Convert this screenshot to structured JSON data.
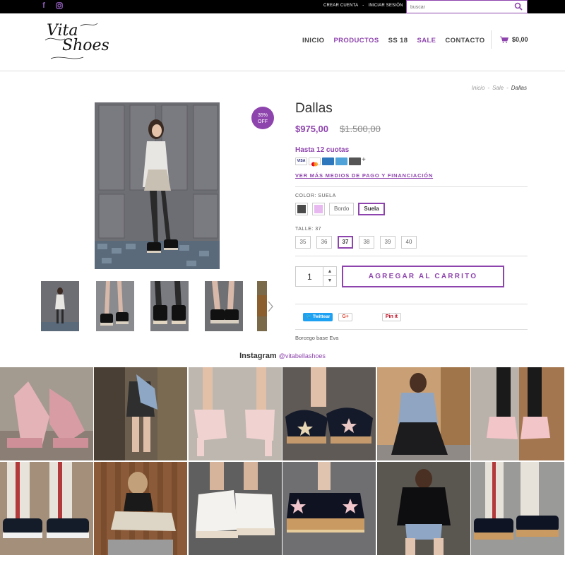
{
  "topbar": {
    "social_icons": [
      "facebook-icon",
      "instagram-icon"
    ],
    "create_account": "CREAR CUENTA",
    "separator": "-",
    "login": "INICIAR SESIÓN",
    "search_placeholder": "buscar"
  },
  "header": {
    "logo_line1": "Vita",
    "logo_line2": "Shoes",
    "nav": [
      {
        "label": "INICIO",
        "accent": false
      },
      {
        "label": "PRODUCTOS",
        "accent": true
      },
      {
        "label": "SS 18",
        "accent": false
      },
      {
        "label": "SALE",
        "accent": true
      },
      {
        "label": "CONTACTO",
        "accent": false
      }
    ],
    "cart_total": "$0,00"
  },
  "breadcrumb": {
    "items": [
      "Inicio",
      "Sale"
    ],
    "current": "Dallas"
  },
  "product": {
    "discount_pct": "35%",
    "discount_word": "OFF",
    "name": "Dallas",
    "price": "$975,00",
    "old_price": "$1.500,00",
    "installments": "Hasta 12 cuotas",
    "payment_link": "VER MÁS MEDIOS DE PAGO Y FINANCIACIÓN",
    "color_label": "COLOR: SUELA",
    "colors": [
      {
        "type": "swatch",
        "hex": "#4a4a4a",
        "selected": false
      },
      {
        "type": "swatch",
        "hex": "#e8b8f0",
        "selected": false
      },
      {
        "type": "text",
        "label": "Bordo",
        "selected": false
      },
      {
        "type": "text",
        "label": "Suela",
        "selected": true
      }
    ],
    "size_label": "TALLE: 37",
    "sizes": [
      {
        "label": "35",
        "selected": false
      },
      {
        "label": "36",
        "selected": false
      },
      {
        "label": "37",
        "selected": true
      },
      {
        "label": "38",
        "selected": false
      },
      {
        "label": "39",
        "selected": false
      },
      {
        "label": "40",
        "selected": false
      }
    ],
    "quantity": "1",
    "add_to_cart": "AGREGAR AL CARRITO",
    "share_twitter": "Twittear",
    "share_gplus": "G+",
    "share_pinterest": "Pin it",
    "description": "Borcego base Eva"
  },
  "instagram": {
    "title": "Instagram",
    "handle": "@vitabellashoes"
  },
  "colors": {
    "accent": "#8e44ad",
    "topbar": "#000000"
  }
}
